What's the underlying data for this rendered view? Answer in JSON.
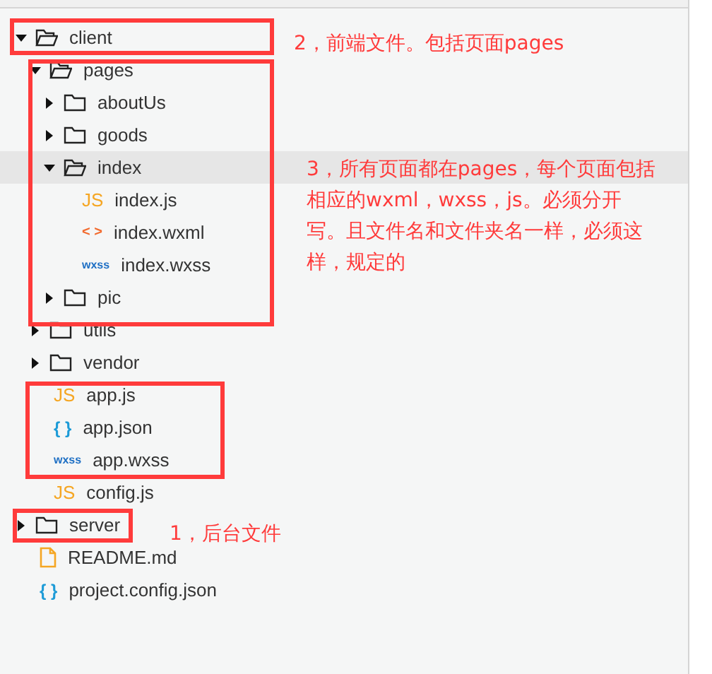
{
  "tree": [
    {
      "name": "client",
      "kind": "folder",
      "expanded": true,
      "selected": false,
      "children": [
        {
          "name": "pages",
          "kind": "folder",
          "expanded": true,
          "selected": false,
          "children": [
            {
              "name": "aboutUs",
              "kind": "folder",
              "expanded": false,
              "selected": false
            },
            {
              "name": "goods",
              "kind": "folder",
              "expanded": false,
              "selected": false
            },
            {
              "name": "index",
              "kind": "folder",
              "expanded": true,
              "selected": true,
              "children": [
                {
                  "name": "index.js",
                  "kind": "js",
                  "glyph": "JS",
                  "selected": false
                },
                {
                  "name": "index.wxml",
                  "kind": "wxml",
                  "glyph": "< >",
                  "selected": false
                },
                {
                  "name": "index.wxss",
                  "kind": "wxss",
                  "glyph": "wxss",
                  "selected": false
                }
              ]
            },
            {
              "name": "pic",
              "kind": "folder",
              "expanded": false,
              "selected": false
            }
          ]
        },
        {
          "name": "utils",
          "kind": "folder",
          "expanded": false,
          "selected": false
        },
        {
          "name": "vendor",
          "kind": "folder",
          "expanded": false,
          "selected": false
        },
        {
          "name": "app.js",
          "kind": "js",
          "glyph": "JS",
          "selected": false
        },
        {
          "name": "app.json",
          "kind": "json",
          "glyph": "{ }",
          "selected": false
        },
        {
          "name": "app.wxss",
          "kind": "wxss",
          "glyph": "wxss",
          "selected": false
        },
        {
          "name": "config.js",
          "kind": "js",
          "glyph": "JS",
          "selected": false
        }
      ]
    },
    {
      "name": "server",
      "kind": "folder",
      "expanded": false,
      "selected": false
    },
    {
      "name": "README.md",
      "kind": "md",
      "selected": false
    },
    {
      "name": "project.config.json",
      "kind": "json",
      "glyph": "{ }",
      "selected": false
    }
  ],
  "annotations": [
    {
      "text": "2，前端文件。包括页面pages"
    },
    {
      "text": "3，所有页面都在pages，每个页面包括相应的wxml，wxss，js。必须分开写。且文件名和文件夹名一样，必须这样，规定的"
    },
    {
      "text": "1，后台文件"
    }
  ]
}
